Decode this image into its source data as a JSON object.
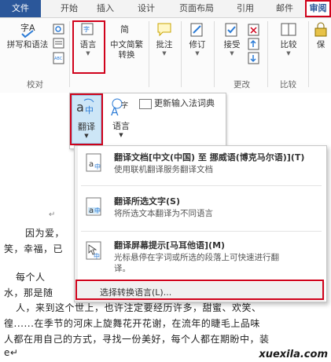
{
  "tabs": [
    {
      "label": "文件"
    },
    {
      "label": "开始"
    },
    {
      "label": "插入"
    },
    {
      "label": "设计"
    },
    {
      "label": "页面布局"
    },
    {
      "label": "引用"
    },
    {
      "label": "邮件"
    },
    {
      "label": "审阅"
    }
  ],
  "ribbon": {
    "spelling_label": "拼写和语法",
    "language_label": "语言",
    "convert_label_1": "中文简繁",
    "convert_label_2": "转换",
    "comment_label": "批注",
    "revise_label": "修订",
    "accept_label": "接受",
    "compare_label": "比较",
    "protect_label": "保",
    "group_proofing": "校对",
    "group_changes": "更改",
    "group_compare": "比较"
  },
  "language_dropdown": {
    "translate_label": "翻译",
    "language_label": "语言",
    "update_ime_label": "更新输入法词典"
  },
  "translate_menu": {
    "items": [
      {
        "title": "翻译文档[中文(中国) 至 挪威语(博克马尔语)](T)",
        "desc": "使用联机翻译服务翻译文档",
        "desc2": ""
      },
      {
        "title": "翻译所选文字(S)",
        "desc": "将所选文本翻译为不同语言",
        "desc2": ""
      },
      {
        "title": "翻译屏幕提示[马耳他语](M)",
        "desc": "光标悬停在字词或所选的段落上可快速进行翻",
        "desc2": "译。"
      }
    ],
    "footer": "选择转换语言(L)..."
  },
  "document": {
    "line1": "↵",
    "line2a": "因为爱，",
    "line2b": "",
    "line3a": "笑，幸福，已",
    "line4a": "每个人",
    "line5a": "水，那是随",
    "line6": "人，来到这个世上，也许注定要经历许多，甜蜜、欢笑、",
    "line7": "徨......在季节的河床上旋舞花开花谢，在流年的睫毛上品味",
    "line8": "人都在用自己的方式，寻找一份美好，每个人都在期盼中，装",
    "line9": "e↵"
  },
  "watermark": "xuexila.com"
}
